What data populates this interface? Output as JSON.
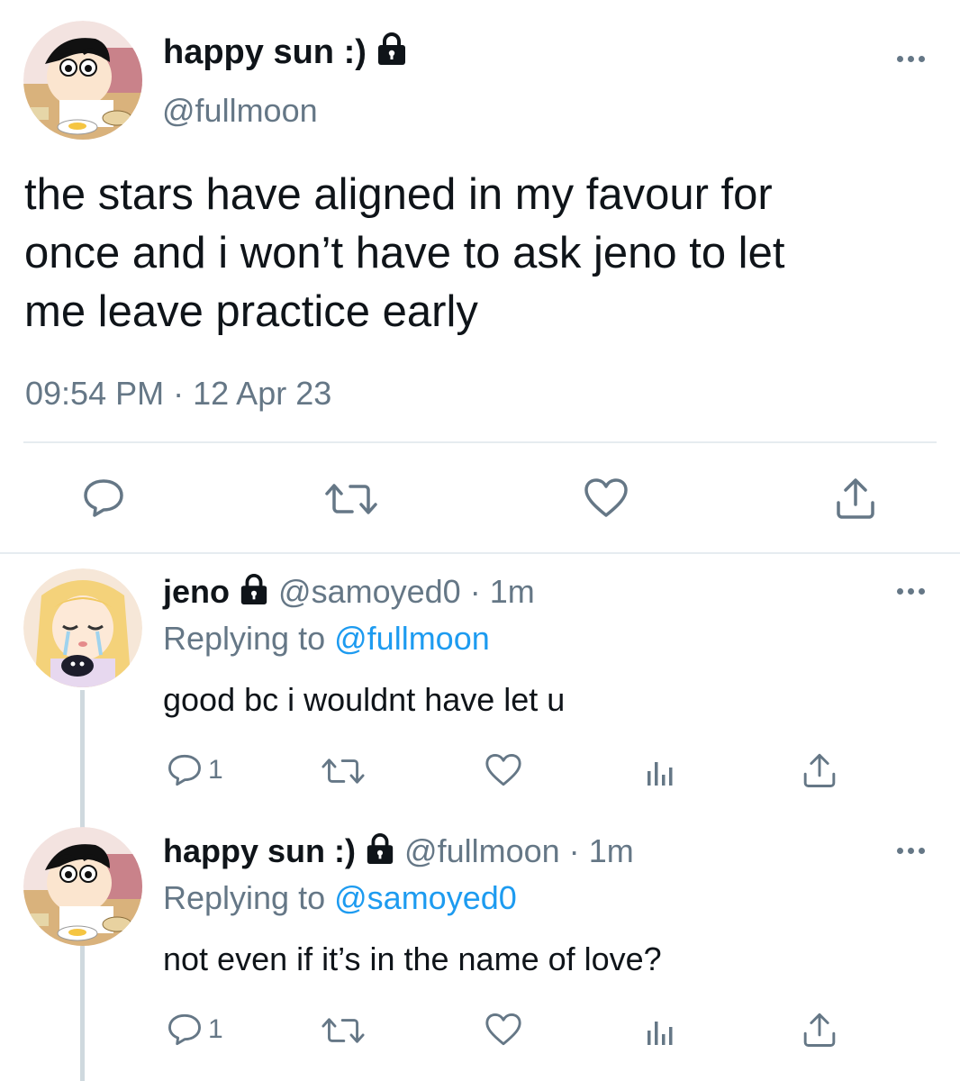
{
  "main_tweet": {
    "display_name": "happy sun :)",
    "handle": "@fullmoon",
    "text_lines": [
      "the stars have aligned in my favour for",
      "once and i won’t have to ask jeno to let",
      "me leave practice early"
    ],
    "time": "09:54 PM",
    "separator": "·",
    "date": "12 Apr 23",
    "icons": [
      "more-icon",
      "lock-icon",
      "reply-icon",
      "retweet-icon",
      "like-icon",
      "share-icon"
    ]
  },
  "replies": [
    {
      "display_name": "jeno",
      "handle": "@samoyed0",
      "separator": "·",
      "age": "1m",
      "replying_prefix": "Replying to",
      "replying_to": "@fullmoon",
      "text": "good bc i wouldnt have let u",
      "reply_count": "1"
    },
    {
      "display_name": "happy sun :)",
      "handle": "@fullmoon",
      "separator": "·",
      "age": "1m",
      "replying_prefix": "Replying to",
      "replying_to": "@samoyed0",
      "text": "not even if it’s in the name of love?",
      "reply_count": "1"
    }
  ],
  "colors": {
    "text": "#0f1419",
    "muted": "#657786",
    "link": "#1d9bf0",
    "divider": "#e6ecf0"
  }
}
